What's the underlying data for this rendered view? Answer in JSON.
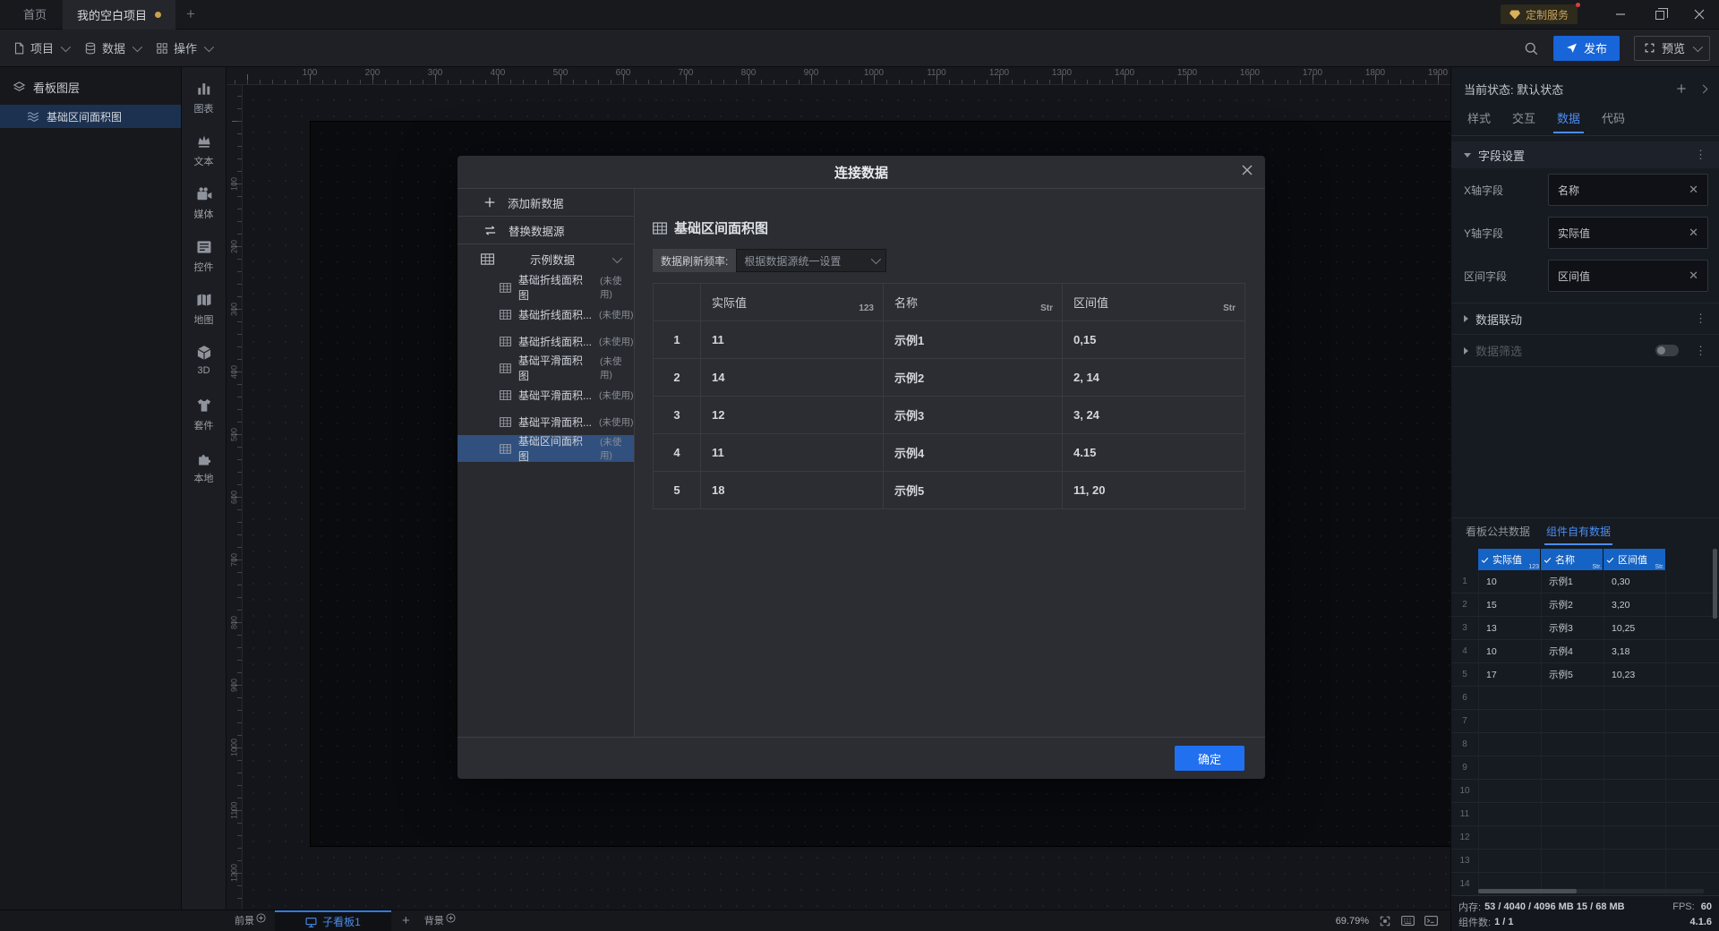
{
  "titlebar": {
    "home_tab": "首页",
    "project_tab": "我的空白项目",
    "new_tab": "+",
    "service_badge": "定制服务"
  },
  "menubar": {
    "project": "项目",
    "data": "数据",
    "action": "操作",
    "publish": "发布",
    "preview": "预览"
  },
  "layers_panel": {
    "title": "看板图层",
    "selected_layer": "基础区间面积图"
  },
  "component_bar": {
    "items": [
      "图表",
      "文本",
      "媒体",
      "控件",
      "地图",
      "3D",
      "套件",
      "本地"
    ]
  },
  "canvas": {
    "h_ruler": [
      "100",
      "200",
      "300",
      "400",
      "500",
      "600",
      "700",
      "800",
      "900",
      "1000",
      "1100",
      "1200",
      "1300",
      "1400",
      "1500",
      "1600",
      "1700",
      "1800",
      "1900"
    ],
    "v_ruler": [
      "100",
      "200",
      "300",
      "400",
      "500",
      "600",
      "700",
      "800",
      "900",
      "1000",
      "1100",
      "1200"
    ]
  },
  "modal": {
    "title": "连接数据",
    "add_new": "添加新数据",
    "replace_source": "替换数据源",
    "source_group": "示例数据",
    "datasets": [
      {
        "name": "基础折线面积图",
        "badge": "(未使用)"
      },
      {
        "name": "基础折线面积...",
        "badge": "(未使用)"
      },
      {
        "name": "基础折线面积...",
        "badge": "(未使用)"
      },
      {
        "name": "基础平滑面积图",
        "badge": "(未使用)"
      },
      {
        "name": "基础平滑面积...",
        "badge": "(未使用)"
      },
      {
        "name": "基础平滑面积...",
        "badge": "(未使用)"
      },
      {
        "name": "基础区间面积图",
        "badge": "(未使用)",
        "selected": true
      }
    ],
    "dataset_title": "基础区间面积图",
    "refresh_label": "数据刷新频率:",
    "refresh_value": "根据数据源统一设置",
    "table": {
      "columns": [
        {
          "label": "实际值",
          "type": "123"
        },
        {
          "label": "名称",
          "type": "Str"
        },
        {
          "label": "区间值",
          "type": "Str"
        }
      ],
      "rows": [
        [
          "1",
          "11",
          "示例1",
          "0,15"
        ],
        [
          "2",
          "14",
          "示例2",
          "2, 14"
        ],
        [
          "3",
          "12",
          "示例3",
          "3, 24"
        ],
        [
          "4",
          "11",
          "示例4",
          "4.15"
        ],
        [
          "5",
          "18",
          "示例5",
          "11, 20"
        ]
      ]
    },
    "confirm": "确定"
  },
  "inspector": {
    "state_label": "当前状态:",
    "state_value": "默认状态",
    "tabs": [
      "样式",
      "交互",
      "数据",
      "代码"
    ],
    "field_settings": "字段设置",
    "fields": [
      {
        "label": "X轴字段",
        "value": "名称"
      },
      {
        "label": "Y轴字段",
        "value": "实际值"
      },
      {
        "label": "区间字段",
        "value": "区间值"
      }
    ],
    "data_link": "数据联动",
    "data_filter": "数据筛选",
    "data_tabs": [
      "看板公共数据",
      "组件自有数据"
    ],
    "grid": {
      "columns": [
        {
          "label": "实际值",
          "type": "123"
        },
        {
          "label": "名称",
          "type": "Str."
        },
        {
          "label": "区间值",
          "type": "Str."
        }
      ],
      "rows": [
        [
          "1",
          "10",
          "示例1",
          "0,30"
        ],
        [
          "2",
          "15",
          "示例2",
          "3,20"
        ],
        [
          "3",
          "13",
          "示例3",
          "10,25"
        ],
        [
          "4",
          "10",
          "示例4",
          "3,18"
        ],
        [
          "5",
          "17",
          "示例5",
          "10,23"
        ],
        [
          "6",
          "",
          "",
          ""
        ],
        [
          "7",
          "",
          "",
          ""
        ],
        [
          "8",
          "",
          "",
          ""
        ],
        [
          "9",
          "",
          "",
          ""
        ],
        [
          "10",
          "",
          "",
          ""
        ],
        [
          "11",
          "",
          "",
          ""
        ],
        [
          "12",
          "",
          "",
          ""
        ],
        [
          "13",
          "",
          "",
          ""
        ],
        [
          "14",
          "",
          "",
          ""
        ]
      ]
    },
    "status": {
      "memory_label": "内存:",
      "memory_value": "53 / 4040 / 4096 MB 15 / 68 MB",
      "fps_label": "FPS:",
      "fps_value": "60",
      "components_label": "组件数:",
      "components_value": "1 / 1",
      "version": "4.1.6"
    }
  },
  "bottombar": {
    "foreground": "前景",
    "board_tab": "子看板1",
    "add": "+",
    "background": "背景",
    "zoom": "69.79%"
  }
}
